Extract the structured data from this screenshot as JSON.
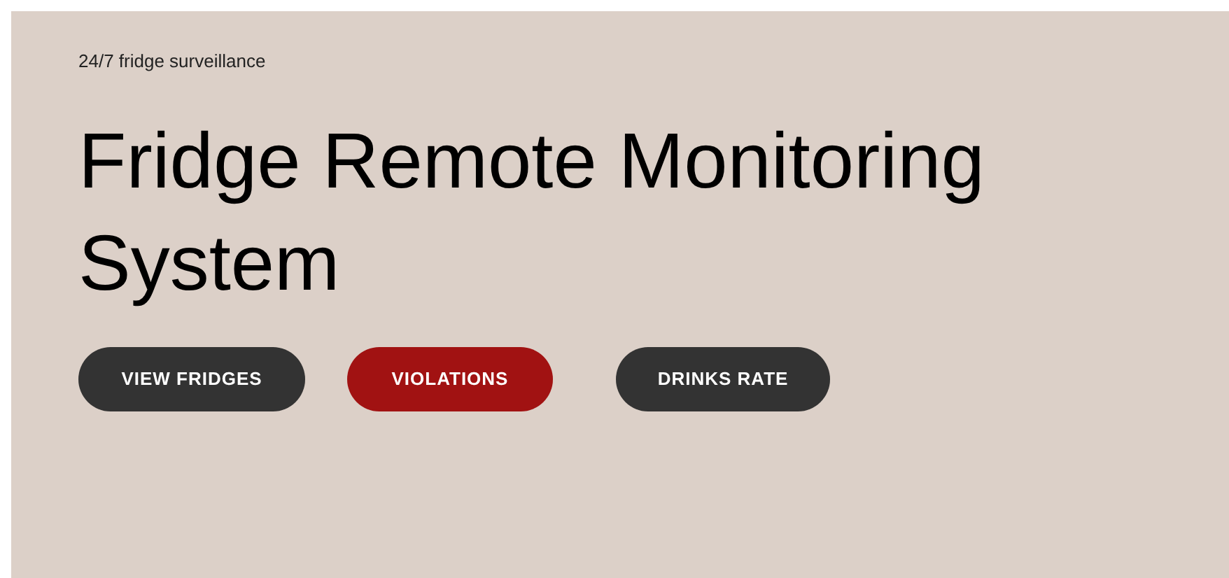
{
  "tagline": "24/7 fridge surveillance",
  "title": "Fridge Remote Monitoring System",
  "buttons": [
    {
      "label": "VIEW FRIDGES",
      "color": "#333333"
    },
    {
      "label": "VIOLATIONS",
      "color": "#a11212"
    },
    {
      "label": "DRINKS RATE",
      "color": "#333333"
    }
  ]
}
